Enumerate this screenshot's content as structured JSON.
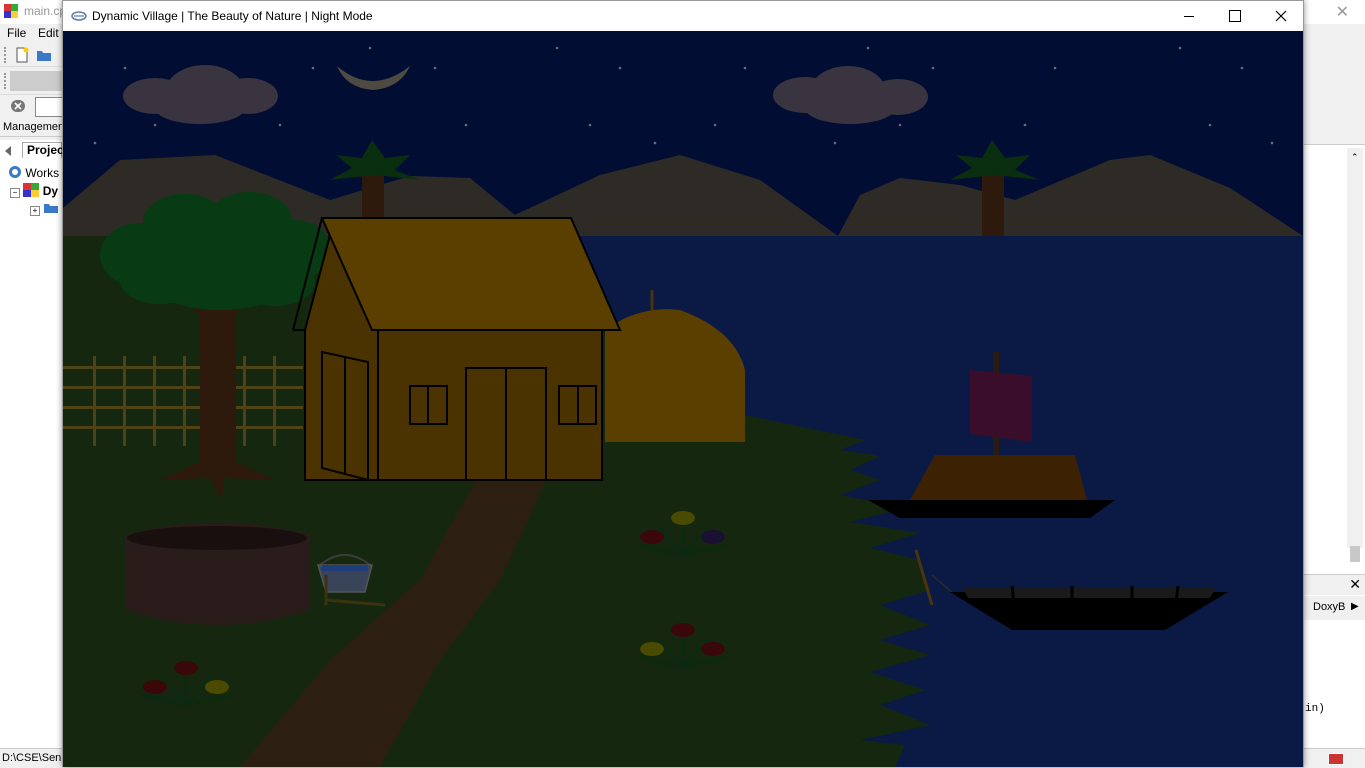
{
  "ide": {
    "title": "main.cp",
    "menu": {
      "file": "File",
      "edit": "Edit"
    },
    "management_label": "Managemen",
    "projects_tab": "Projec",
    "tree": {
      "workspace": "Works",
      "project": "Dy"
    },
    "status_path": "D:\\CSE\\Sen",
    "right_panel": {
      "doxy_label": "DoxyB",
      "code_fragment": "in)"
    }
  },
  "window": {
    "title": "Dynamic Village | The Beauty of Nature | Night Mode",
    "minimize_glyph": "—",
    "maximize_glyph": "☐",
    "close_glyph": "✕"
  },
  "scene": {
    "mode": "night",
    "colors": {
      "sky": "#020d33",
      "water": "#0b1a44",
      "hills": "#2e2b27",
      "grass": "#15280f",
      "house": "#4a3300",
      "roof": "#5a3f00",
      "tree_leaves": "#083b14",
      "trunk": "#2e1a0c",
      "path": "#2c1f12",
      "fence": "#4f4214",
      "clouds": "#3a3440",
      "moon": "#4d4a42",
      "sail": "#3a0e2a",
      "boat_hull": "#000000",
      "boat_cabin": "#3c2203",
      "well": "#2a1c1b"
    }
  }
}
